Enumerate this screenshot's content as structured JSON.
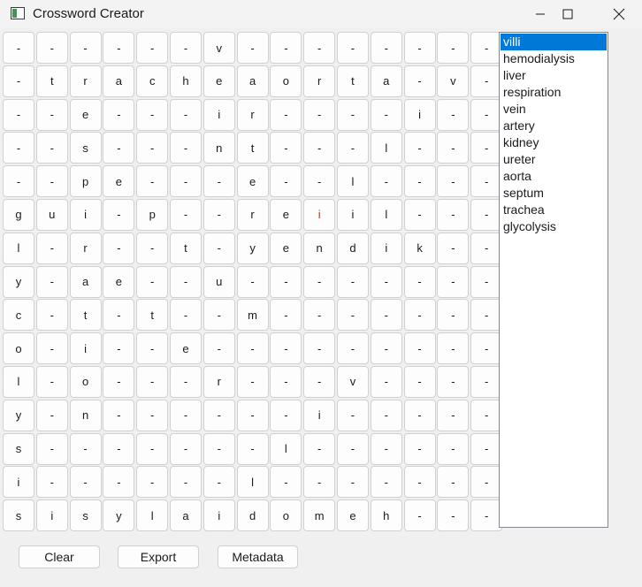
{
  "window": {
    "title": "Crossword Creator"
  },
  "grid": {
    "rows": [
      [
        "-",
        "-",
        "-",
        "-",
        "-",
        "-",
        "v",
        "-",
        "-",
        "-",
        "-",
        "-",
        "-",
        "-",
        "-"
      ],
      [
        "-",
        "t",
        "r",
        "a",
        "c",
        "h",
        "e",
        "a",
        "o",
        "r",
        "t",
        "a",
        "-",
        "v",
        "-"
      ],
      [
        "-",
        "-",
        "e",
        "-",
        "-",
        "-",
        "i",
        "r",
        "-",
        "-",
        "-",
        "-",
        "i",
        "-",
        "-"
      ],
      [
        "-",
        "-",
        "s",
        "-",
        "-",
        "-",
        "n",
        "t",
        "-",
        "-",
        "-",
        "l",
        "-",
        "-",
        "-"
      ],
      [
        "-",
        "-",
        "p",
        "e",
        "-",
        "-",
        "-",
        "e",
        "-",
        "-",
        "l",
        "-",
        "-",
        "-",
        "-"
      ],
      [
        "g",
        "u",
        "i",
        "-",
        "p",
        "-",
        "-",
        "r",
        "e",
        "i",
        "i",
        "l",
        "-",
        "-",
        "-"
      ],
      [
        "l",
        "-",
        "r",
        "-",
        "-",
        "t",
        "-",
        "y",
        "e",
        "n",
        "d",
        "i",
        "k",
        "-",
        "-"
      ],
      [
        "y",
        "-",
        "a",
        "e",
        "-",
        "-",
        "u",
        "-",
        "-",
        "-",
        "-",
        "-",
        "-",
        "-",
        "-"
      ],
      [
        "c",
        "-",
        "t",
        "-",
        "t",
        "-",
        "-",
        "m",
        "-",
        "-",
        "-",
        "-",
        "-",
        "-",
        "-"
      ],
      [
        "o",
        "-",
        "i",
        "-",
        "-",
        "e",
        "-",
        "-",
        "-",
        "-",
        "-",
        "-",
        "-",
        "-",
        "-"
      ],
      [
        "l",
        "-",
        "o",
        "-",
        "-",
        "-",
        "r",
        "-",
        "-",
        "-",
        "v",
        "-",
        "-",
        "-",
        "-"
      ],
      [
        "y",
        "-",
        "n",
        "-",
        "-",
        "-",
        "-",
        "-",
        "-",
        "i",
        "-",
        "-",
        "-",
        "-",
        "-"
      ],
      [
        "s",
        "-",
        "-",
        "-",
        "-",
        "-",
        "-",
        "-",
        "l",
        "-",
        "-",
        "-",
        "-",
        "-",
        "-"
      ],
      [
        "i",
        "-",
        "-",
        "-",
        "-",
        "-",
        "-",
        "l",
        "-",
        "-",
        "-",
        "-",
        "-",
        "-",
        "-"
      ],
      [
        "s",
        "i",
        "s",
        "y",
        "l",
        "a",
        "i",
        "d",
        "o",
        "m",
        "e",
        "h",
        "-",
        "-",
        "-"
      ]
    ],
    "highlighted": [
      [
        5,
        9
      ]
    ],
    "highlight_color": "#e02020"
  },
  "word_list": {
    "selected_index": 0,
    "selected_color": "#0078d7",
    "items": [
      "villi",
      "hemodialysis",
      "liver",
      "respiration",
      "vein",
      "artery",
      "kidney",
      "ureter",
      "aorta",
      "septum",
      "trachea",
      "glycolysis"
    ]
  },
  "buttons": {
    "clear": "Clear",
    "export": "Export",
    "metadata": "Metadata"
  }
}
